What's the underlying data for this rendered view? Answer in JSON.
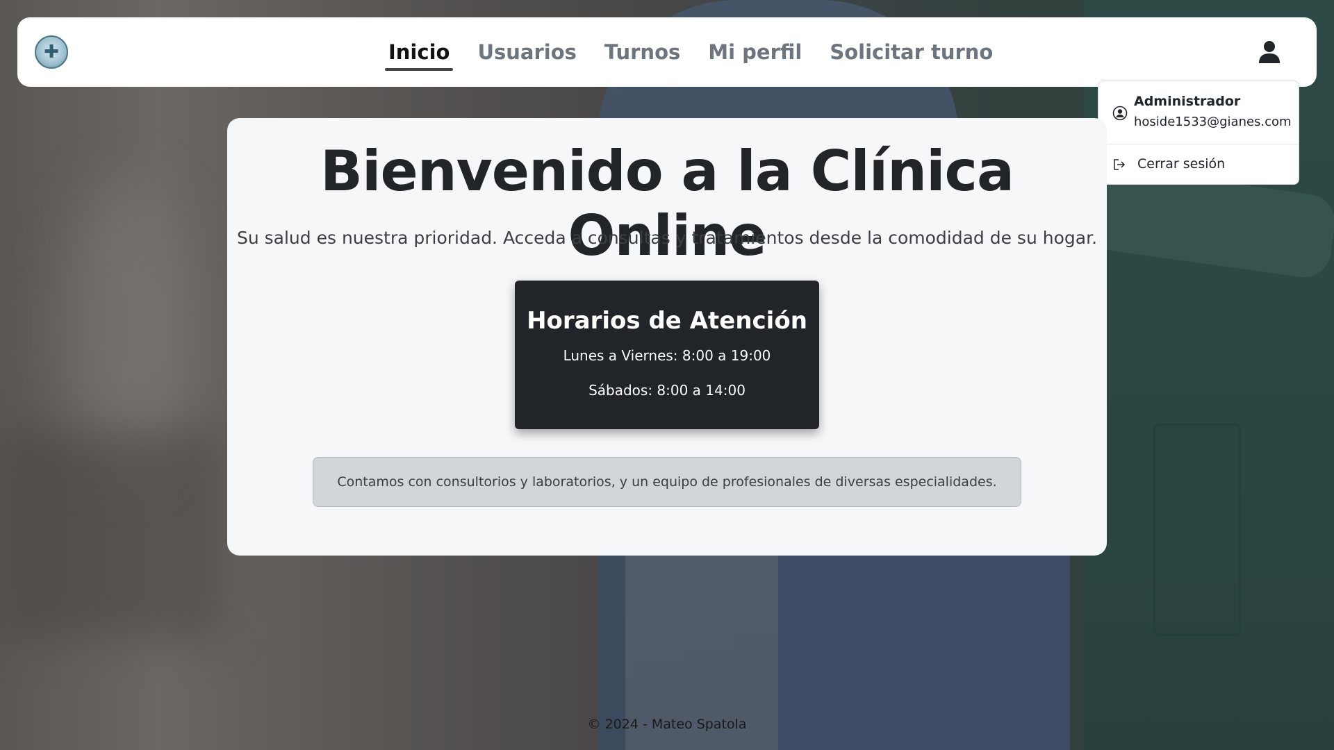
{
  "nav": {
    "items": [
      {
        "label": "Inicio",
        "active": true
      },
      {
        "label": "Usuarios",
        "active": false
      },
      {
        "label": "Turnos",
        "active": false
      },
      {
        "label": "Mi perfil",
        "active": false
      },
      {
        "label": "Solicitar turno",
        "active": false
      }
    ],
    "logo_icon": "clinic-logo-icon",
    "user_icon": "user-icon"
  },
  "dropdown": {
    "role": "Administrador",
    "email": "hoside1533@gianes.com",
    "logout_label": "Cerrar sesión"
  },
  "main": {
    "title": "Bienvenido a la Clínica Online",
    "subtitle": "Su salud es nuestra prioridad. Acceda a consultas y tratamientos desde la comodidad de su hogar.",
    "hours": {
      "title": "Horarios de Atención",
      "weekdays": "Lunes a Viernes: 8:00 a 19:00",
      "saturday": "Sábados: 8:00 a 14:00"
    },
    "info": "Contamos con consultorios y laboratorios, y un equipo de profesionales de diversas especialidades."
  },
  "footer": {
    "text": "© 2024 - Mateo Spatola"
  },
  "colors": {
    "dark": "#212529",
    "muted_nav": "#6c757d",
    "card_bg": "#f6f7f9",
    "info_bg": "#d2d5da"
  }
}
